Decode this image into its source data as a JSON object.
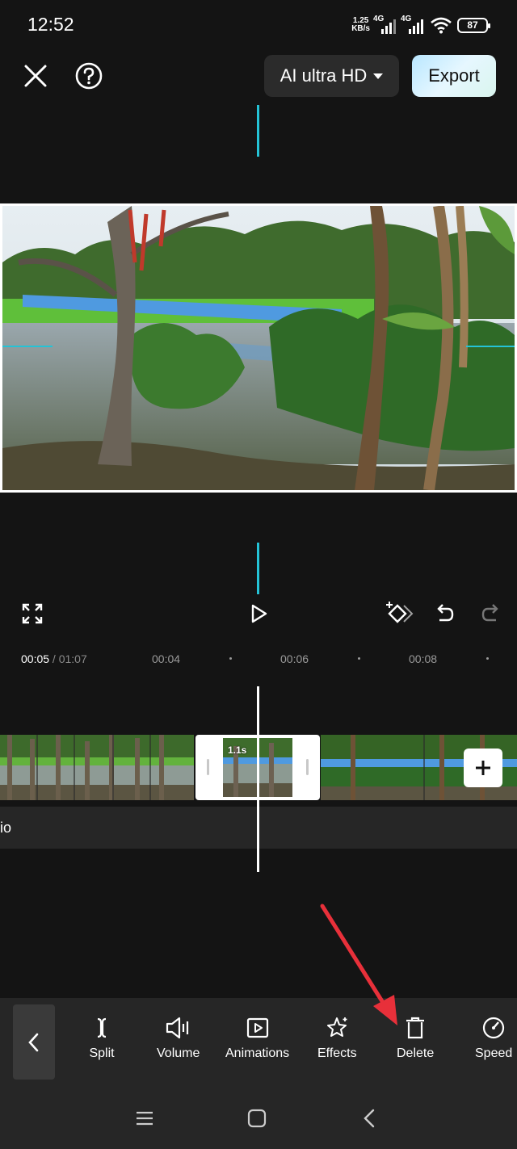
{
  "status": {
    "time": "12:52",
    "speed_value": "1.25",
    "speed_unit": "KB/s",
    "net1": "4G",
    "net2": "4G",
    "battery": "87"
  },
  "topbar": {
    "quality_label": "AI ultra HD",
    "export_label": "Export"
  },
  "ruler": {
    "current": "00:05",
    "total": " / 01:07",
    "ticks": [
      "00:04",
      "00:06",
      "00:08"
    ]
  },
  "timeline": {
    "clip_duration": "1.1s",
    "audio_label": "io"
  },
  "toolbar": {
    "tools": [
      {
        "label": "Split",
        "icon": "split-icon"
      },
      {
        "label": "Volume",
        "icon": "volume-icon"
      },
      {
        "label": "Animations",
        "icon": "animations-icon"
      },
      {
        "label": "Effects",
        "icon": "effects-icon"
      },
      {
        "label": "Delete",
        "icon": "delete-icon"
      },
      {
        "label": "Speed",
        "icon": "speed-icon"
      }
    ]
  },
  "colors": {
    "accent_cyan": "#24c3d6",
    "arrow_red": "#e8303a",
    "background": "#141414",
    "panel": "#262626"
  }
}
